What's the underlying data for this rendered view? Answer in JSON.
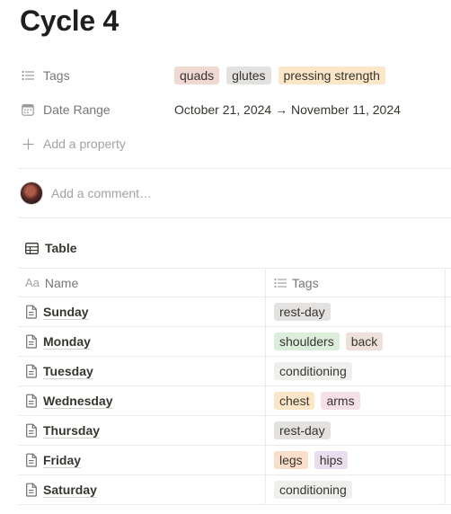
{
  "page": {
    "title": "Cycle 4"
  },
  "properties": {
    "tags": {
      "label": "Tags",
      "icon": "list-icon",
      "values": [
        {
          "label": "quads",
          "color": "#f0d9d3"
        },
        {
          "label": "glutes",
          "color": "#e3e2e0"
        },
        {
          "label": "pressing strength",
          "color": "#fbe7c8"
        }
      ]
    },
    "date_range": {
      "label": "Date Range",
      "icon": "calendar-icon",
      "value": "October 21, 2024 → November 11, 2024"
    },
    "add_property": {
      "label": "Add a property",
      "icon": "plus-icon"
    }
  },
  "comment": {
    "placeholder": "Add a comment…"
  },
  "view": {
    "label": "Table",
    "icon": "table-icon"
  },
  "table": {
    "columns": [
      {
        "label": "Name",
        "icon": "text-aa-icon"
      },
      {
        "label": "Tags",
        "icon": "list-icon"
      }
    ],
    "rows": [
      {
        "name": "Sunday",
        "tags": [
          {
            "label": "rest-day",
            "color": "#e3e2e0"
          }
        ]
      },
      {
        "name": "Monday",
        "tags": [
          {
            "label": "shoulders",
            "color": "#dbeddb"
          },
          {
            "label": "back",
            "color": "#eee0da"
          }
        ]
      },
      {
        "name": "Tuesday",
        "tags": [
          {
            "label": "conditioning",
            "color": "#efefed"
          }
        ]
      },
      {
        "name": "Wednesday",
        "tags": [
          {
            "label": "chest",
            "color": "#fbe7c8"
          },
          {
            "label": "arms",
            "color": "#f5e0e9"
          }
        ]
      },
      {
        "name": "Thursday",
        "tags": [
          {
            "label": "rest-day",
            "color": "#e3e2e0"
          }
        ]
      },
      {
        "name": "Friday",
        "tags": [
          {
            "label": "legs",
            "color": "#fadec9"
          },
          {
            "label": "hips",
            "color": "#e8deee"
          }
        ]
      },
      {
        "name": "Saturday",
        "tags": [
          {
            "label": "conditioning",
            "color": "#efefed"
          }
        ]
      }
    ]
  }
}
